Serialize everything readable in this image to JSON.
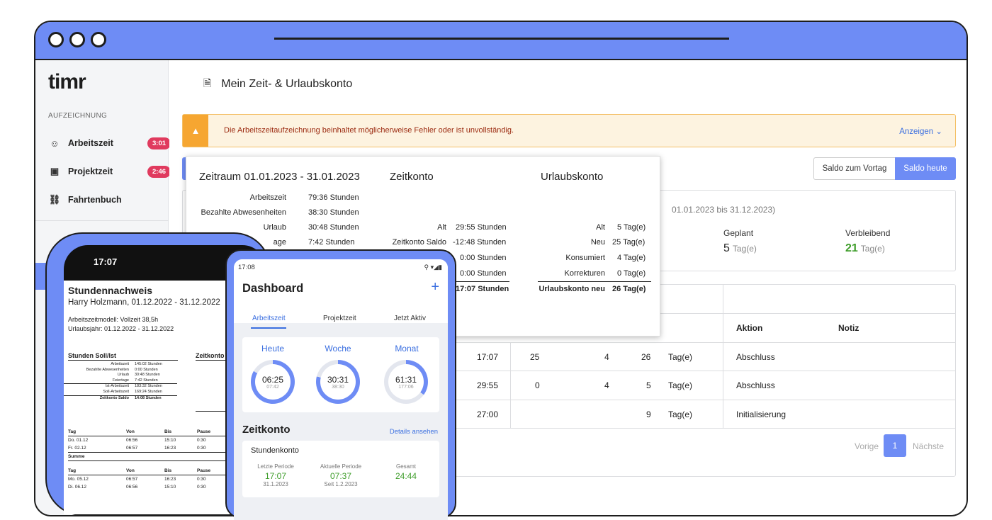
{
  "app": {
    "logo": "timr"
  },
  "sidebar": {
    "section": "AUFZEICHNUNG",
    "items": [
      {
        "label": "Arbeitszeit",
        "badge": "3:01"
      },
      {
        "label": "Projektzeit",
        "badge": "2:46"
      },
      {
        "label": "Fahrtenbuch"
      }
    ]
  },
  "page": {
    "title": "Mein Zeit- & Urlaubskonto"
  },
  "alert": {
    "text": "Die Arbeitszeitaufzeichnung beinhaltet möglicherweise Fehler oder ist unvollständig.",
    "link": "Anzeigen"
  },
  "toolbar": {
    "saldo_vortag": "Saldo zum Vortag",
    "saldo_heute": "Saldo heute"
  },
  "summary": {
    "range": "01.01.2023 bis 31.12.2023)",
    "geplant_label": "Geplant",
    "geplant_value": "5",
    "geplant_unit": "Tag(e)",
    "verbleibend_label": "Verbleibend",
    "verbleibend_value": "21",
    "verbleibend_unit": "Tag(e)"
  },
  "table": {
    "headers": {
      "aktion": "Aktion",
      "notiz": "Notiz"
    },
    "rows": [
      {
        "zeit": "17:07",
        "a": "25",
        "b": "4",
        "c": "26",
        "unit": "Tag(e)",
        "aktion": "Abschluss"
      },
      {
        "zeit": "29:55",
        "a": "0",
        "b": "4",
        "c": "5",
        "unit": "Tag(e)",
        "aktion": "Abschluss"
      },
      {
        "zeit": "27:00",
        "a": "",
        "b": "",
        "c": "9",
        "unit": "Tag(e)",
        "aktion": "Initialisierung"
      }
    ],
    "pagination": {
      "prev": "Vorige",
      "page": "1",
      "next": "Nächste"
    }
  },
  "popup": {
    "period_title": "Zeitraum 01.01.2023 - 31.01.2023",
    "zeitkonto_title": "Zeitkonto",
    "urlaubskonto_title": "Urlaubskonto",
    "period": [
      {
        "label": "Arbeitszeit",
        "value": "79:36 Stunden"
      },
      {
        "label": "Bezahlte Abwesenheiten",
        "value": "38:30 Stunden"
      },
      {
        "label": "Urlaub",
        "value": "30:48 Stunden"
      },
      {
        "label": "age",
        "value": "7:42 Stunden"
      }
    ],
    "zeitkonto": [
      {
        "label": "Alt",
        "value": "29:55 Stunden"
      },
      {
        "label": "Zeitkonto Saldo",
        "value": "-12:48 Stunden"
      },
      {
        "label": "",
        "value": "0:00 Stunden"
      },
      {
        "label": "",
        "value": "0:00 Stunden"
      },
      {
        "label": "",
        "value": "17:07 Stunden"
      }
    ],
    "urlaubskonto": [
      {
        "label": "Alt",
        "value": "5 Tag(e)"
      },
      {
        "label": "Neu",
        "value": "25 Tag(e)"
      },
      {
        "label": "Konsumiert",
        "value": "4 Tag(e)"
      },
      {
        "label": "Korrekturen",
        "value": "0 Tag(e)"
      },
      {
        "label": "Urlaubskonto neu",
        "value": "26 Tag(e)"
      }
    ]
  },
  "phone1": {
    "time": "17:07",
    "doc_title": "Stundennachweis",
    "doc_person": "Harry Holzmann, 01.12.2022 - 31.12.2022",
    "doc_model": "Arbeitszeitmodell: Vollzeit 38,5h",
    "doc_urlaub": "Urlaubsjahr: 01.12.2022 - 31.12.2022",
    "soll_ist": "Stunden Soll/Ist",
    "zeitkonto": "Zeitkonto",
    "rows": [
      {
        "l": "Arbeitszeit",
        "v": "145:02 Stunden"
      },
      {
        "l": "Bezahlte Abwesenheiten",
        "v": "0:00 Stunden"
      },
      {
        "l": "Urlaub",
        "v": "30:48 Stunden"
      },
      {
        "l": "Feiertage",
        "v": "7:42 Stunden"
      },
      {
        "l": "Ist-Arbeitszeit",
        "v": "183:32 Stunden"
      },
      {
        "l": "Soll-Arbeitszeit",
        "v": "169:24 Stunden"
      },
      {
        "l": "Zeitkonto Saldo",
        "v": "14:08 Stunden"
      }
    ],
    "table_head": [
      "Tag",
      "Von",
      "Bis",
      "Pause"
    ],
    "table1": [
      [
        "Do. 01.12",
        "06:56",
        "15:10",
        "0:30"
      ],
      [
        "Fr. 02.12",
        "06:57",
        "16:23",
        "0:30"
      ]
    ],
    "summe": "Summe",
    "table2": [
      [
        "Mo. 05.12",
        "06:57",
        "16:23",
        "0:30"
      ],
      [
        "Di. 06.12",
        "06:56",
        "15:10",
        "0:30"
      ]
    ]
  },
  "phone2": {
    "time": "17:08",
    "title": "Dashboard",
    "plus": "+",
    "tabs": [
      "Arbeitszeit",
      "Projektzeit",
      "Jetzt Aktiv"
    ],
    "rings": [
      {
        "label": "Heute",
        "value": "06:25",
        "sub": "07:42",
        "fraction": 0.83
      },
      {
        "label": "Woche",
        "value": "30:31",
        "sub": "38:30",
        "fraction": 0.79
      },
      {
        "label": "Monat",
        "value": "61:31",
        "sub": "177:06",
        "fraction": 0.35
      }
    ],
    "zeitkonto_title": "Zeitkonto",
    "details": "Details ansehen",
    "stundenkonto": "Stundenkonto",
    "cols": [
      {
        "label": "Letzte Periode",
        "value": "17:07",
        "sub": "31.1.2023"
      },
      {
        "label": "Aktuelle Periode",
        "value": "07:37",
        "sub": "Seit 1.2.2023"
      },
      {
        "label": "Gesamt",
        "value": "24:44",
        "sub": ""
      }
    ]
  },
  "colors": {
    "accent": "#6e8cf5",
    "badge": "#e03a5e",
    "warning": "#f6a631",
    "positive": "#3e9d2a"
  }
}
